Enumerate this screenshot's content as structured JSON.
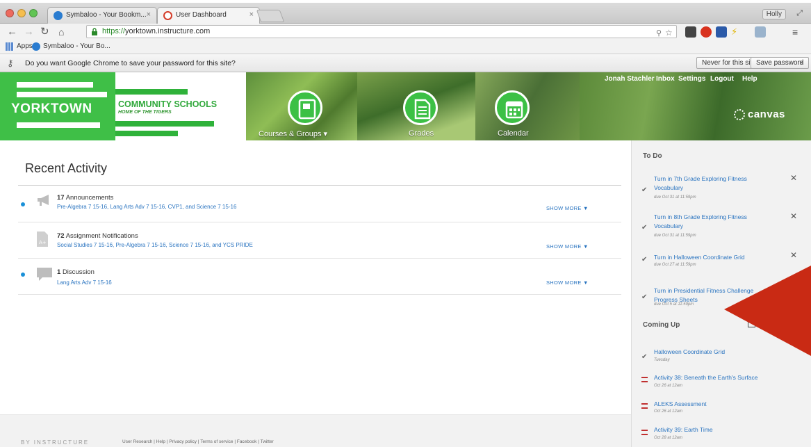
{
  "browser": {
    "tabs": [
      {
        "label": "Symbaloo - Your Bookm...",
        "favicon_color": "#2a7cd0"
      },
      {
        "label": "User Dashboard",
        "favicon_color": "#d43d2a"
      }
    ],
    "profile": "Holly",
    "url_scheme": "https://",
    "url_host": "yorktown.instructure.com",
    "bookmarks": [
      "Apps",
      "Symbaloo - Your Bo..."
    ],
    "password_prompt": "Do you want Google Chrome to save your password for this site?",
    "never_btn": "Never for this site",
    "save_btn": "Save password"
  },
  "header": {
    "school_name": "YORKTOWN",
    "school_sub": "COMMUNITY SCHOOLS",
    "motto": "HOME OF THE TIGERS",
    "nav": [
      {
        "label": "Courses & Groups ▾"
      },
      {
        "label": "Grades"
      },
      {
        "label": "Calendar"
      }
    ],
    "user_links": [
      "Jonah Stachler",
      "Inbox",
      "Settings",
      "Logout",
      "Help"
    ],
    "brand": "canvas",
    "accent": "#35a63e"
  },
  "main": {
    "title": "Recent Activity",
    "items": [
      {
        "count": "17",
        "title": "Announcements",
        "links": "Pre-Algebra 7 15-16, Lang Arts Adv 7 15-16, CVP1, and Science 7 15-16",
        "show_more": "SHOW MORE ▼"
      },
      {
        "count": "72",
        "title": "Assignment Notifications",
        "links": "Social Studies 7 15-16, Pre-Algebra 7 15-16, Science 7 15-16, and YCS PRIDE",
        "show_more": "SHOW MORE ▼"
      },
      {
        "count": "1",
        "title": "Discussion",
        "links": "Lang Arts Adv 7 15-16",
        "show_more": "SHOW MORE ▼"
      }
    ]
  },
  "sidebar": {
    "todo_heading": "To Do",
    "todo": [
      {
        "title": "Turn in 7th Grade Exploring Fitness Vocabulary",
        "due": "due Oct 31 at 11:59pm"
      },
      {
        "title": "Turn in 8th Grade Exploring Fitness Vocabulary",
        "due": "due Oct 31 at 11:59pm"
      },
      {
        "title": "Turn in Halloween Coordinate Grid",
        "due": "due Oct 27 at 11:59pm"
      },
      {
        "title": "Turn in Presidential Fitness Challenge Progress Sheets",
        "due": "due Oct 5 at 11:59pm"
      }
    ],
    "coming_heading": "Coming Up",
    "coming": [
      {
        "title": "Halloween Coordinate Grid",
        "when": "Tuesday"
      },
      {
        "title": "Activity 38: Beneath the Earth's Surface",
        "when": "Oct 26 at 12am"
      },
      {
        "title": "ALEKS Assessment",
        "when": "Oct 26 at 12am"
      },
      {
        "title": "Activity 39: Earth Time",
        "when": "Oct 28 at 12am"
      }
    ]
  },
  "footer": {
    "brand": "BY INSTRUCTURE",
    "links": "User Research | Help | Privacy policy | Terms of service | Facebook | Twitter"
  }
}
